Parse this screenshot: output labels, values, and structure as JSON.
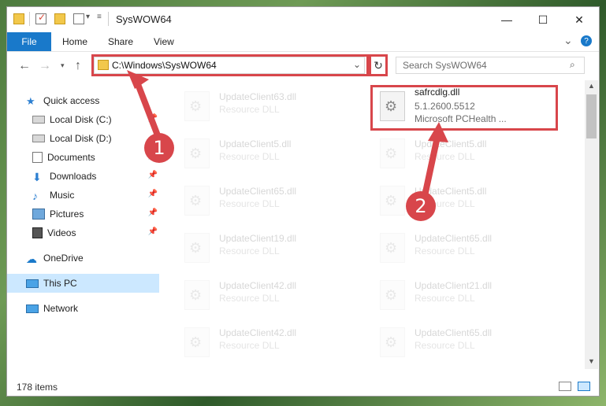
{
  "window": {
    "title": "SysWOW64",
    "minimize": "—",
    "maximize": "☐",
    "close": "✕"
  },
  "ribbon": {
    "file": "File",
    "home": "Home",
    "share": "Share",
    "view": "View",
    "collapse": "⌄",
    "help": "?"
  },
  "address": {
    "path": "C:\\Windows\\SysWOW64",
    "search_placeholder": "Search SysWOW64"
  },
  "nav_pane": [
    {
      "label": "Quick access",
      "icon": "star-icon",
      "pinned": false
    },
    {
      "label": "Local Disk (C:)",
      "icon": "drive-icon",
      "pinned": true
    },
    {
      "label": "Local Disk (D:)",
      "icon": "drive-icon",
      "pinned": false
    },
    {
      "label": "Documents",
      "icon": "documents-icon",
      "pinned": true
    },
    {
      "label": "Downloads",
      "icon": "downloads-icon",
      "pinned": true
    },
    {
      "label": "Music",
      "icon": "music-icon",
      "pinned": true
    },
    {
      "label": "Pictures",
      "icon": "pictures-icon",
      "pinned": true
    },
    {
      "label": "Videos",
      "icon": "videos-icon",
      "pinned": true
    },
    {
      "label": "OneDrive",
      "icon": "onedrive-icon",
      "pinned": false
    },
    {
      "label": "This PC",
      "icon": "computer-icon",
      "pinned": false,
      "selected": true
    },
    {
      "label": "Network",
      "icon": "network-icon",
      "pinned": false
    }
  ],
  "files_left": [
    {
      "name": "UpdateClient63.dll",
      "type": "Resource DLL"
    },
    {
      "name": "UpdateClient5.dll",
      "type": "Resource DLL"
    },
    {
      "name": "UpdateClient65.dll",
      "type": "Resource DLL"
    },
    {
      "name": "UpdateClient19.dll",
      "type": "Resource DLL"
    },
    {
      "name": "UpdateClient42.dll",
      "type": "Resource DLL"
    },
    {
      "name": "UpdateClient42.dll",
      "type": "Resource DLL"
    }
  ],
  "files_right": [
    {
      "name": "safrcdlg.dll",
      "version": "5.1.2600.5512",
      "desc": "Microsoft PCHealth ...",
      "highlighted": true
    },
    {
      "name": "UpdateClient5.dll",
      "type": "Resource DLL"
    },
    {
      "name": "UpdateClient5.dll",
      "type": "Resource DLL"
    },
    {
      "name": "UpdateClient65.dll",
      "type": "Resource DLL"
    },
    {
      "name": "UpdateClient21.dll",
      "type": "Resource DLL"
    },
    {
      "name": "UpdateClient65.dll",
      "type": "Resource DLL"
    }
  ],
  "status": {
    "item_count": "178 items"
  },
  "callouts": {
    "one": "1",
    "two": "2"
  },
  "colors": {
    "accent": "#1979ca",
    "highlight": "#d8464b",
    "selected_nav": "#cce8ff"
  }
}
